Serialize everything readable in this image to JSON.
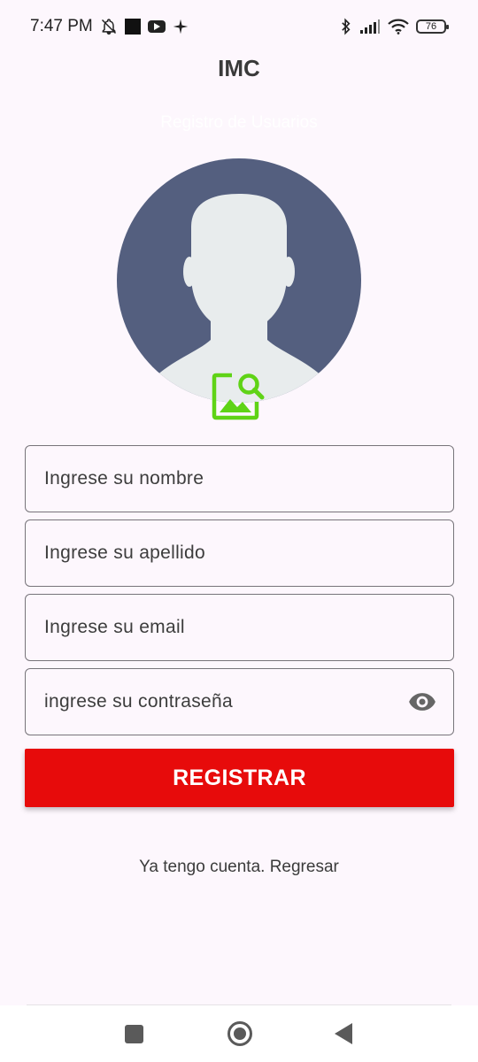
{
  "status_bar": {
    "time": "7:47 PM",
    "battery": "76",
    "icons": [
      "bell-off-icon",
      "square-icon",
      "youtube-icon",
      "sparkle-icon",
      "bluetooth-icon",
      "signal-icon",
      "wifi-icon",
      "battery-icon"
    ]
  },
  "app": {
    "title": "IMC",
    "subtitle": "Registro de Usuarios"
  },
  "form": {
    "name_placeholder": "Ingrese su nombre",
    "lastname_placeholder": "Ingrese su apellido",
    "email_placeholder": "Ingrese su email",
    "password_placeholder": "ingrese su contraseña",
    "register_label": "REGISTRAR",
    "back_link": "Ya tengo cuenta. Regresar"
  },
  "colors": {
    "background": "#fdf7fd",
    "avatar_bg": "#545f7f",
    "avatar_figure": "#e8eced",
    "accent_green": "#5fd316",
    "button_red": "#e70b0b"
  },
  "icons": {
    "avatar": "person-silhouette-icon",
    "image_picker": "image-search-icon",
    "password_toggle": "eye-icon"
  }
}
